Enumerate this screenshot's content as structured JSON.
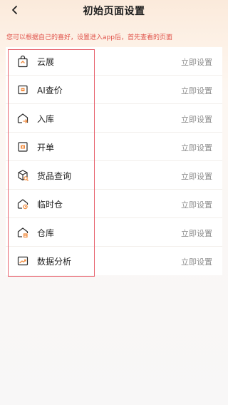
{
  "header": {
    "title": "初始页面设置",
    "back_icon": "chevron-left-icon"
  },
  "hint": "您可以根据自己的喜好，设置进入app后，首先查看的页面",
  "colors": {
    "accent": "#f08a3c",
    "hint": "#e0524a",
    "highlight_border": "#e86570"
  },
  "items": [
    {
      "label": "云展",
      "action": "立即设置",
      "icon": "shopping-bag-icon"
    },
    {
      "label": "AI查价",
      "action": "立即设置",
      "icon": "price-tag-icon"
    },
    {
      "label": "入库",
      "action": "立即设置",
      "icon": "warehouse-in-icon"
    },
    {
      "label": "开单",
      "action": "立即设置",
      "icon": "order-sheet-icon"
    },
    {
      "label": "货品查询",
      "action": "立即设置",
      "icon": "package-search-icon"
    },
    {
      "label": "临时仓",
      "action": "立即设置",
      "icon": "temp-warehouse-icon"
    },
    {
      "label": "仓库",
      "action": "立即设置",
      "icon": "warehouse-icon"
    },
    {
      "label": "数据分析",
      "action": "立即设置",
      "icon": "trend-chart-icon"
    }
  ]
}
